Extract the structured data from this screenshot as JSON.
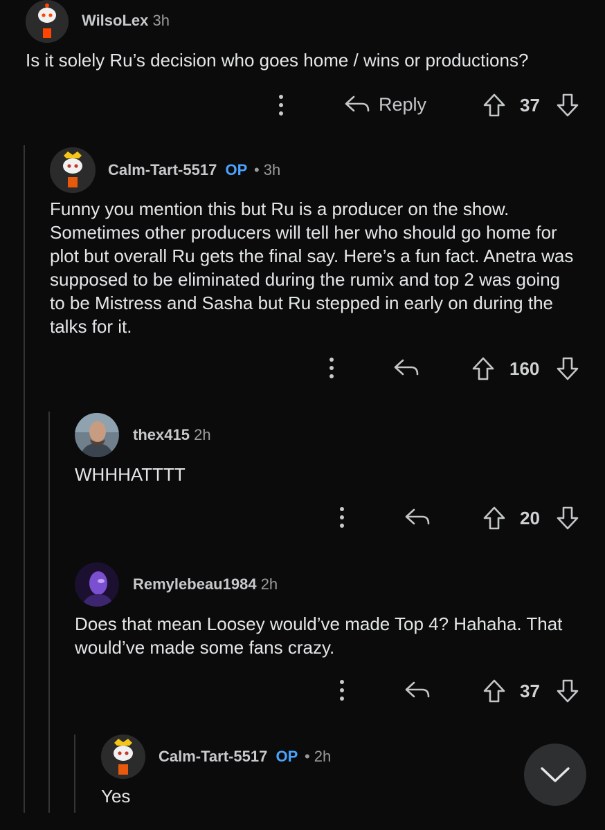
{
  "comments": [
    {
      "username": "WilsoLex",
      "time": "3h",
      "op_badge": "",
      "body": "Is it solely Ru’s decision who goes home / wins or productions?",
      "reply_label": "Reply",
      "votes": "37",
      "avatar_icon": "snoo-avatar-icon"
    },
    {
      "username": "Calm-Tart-5517",
      "time": "3h",
      "op_badge": "OP",
      "separator": "•",
      "body": "Funny you mention this but Ru is a producer on the show. Sometimes other producers will tell her who should go home for plot but overall Ru gets the final say. Here’s a fun fact. Anetra was supposed to be eliminated during the rumix and top 2 was going to be Mistress and Sasha but Ru stepped in early on during the talks for it.",
      "votes": "160",
      "avatar_icon": "snoo-avatar-icon"
    },
    {
      "username": "thex415",
      "time": "2h",
      "op_badge": "",
      "body": "WHHHATTTT",
      "votes": "20",
      "avatar_icon": "photo-avatar-icon"
    },
    {
      "username": "Remylebeau1984",
      "time": "2h",
      "op_badge": "",
      "body": "Does that mean Loosey would’ve made Top 4? Hahaha. That would’ve made some fans crazy.",
      "votes": "37",
      "avatar_icon": "photo-avatar-icon"
    },
    {
      "username": "Calm-Tart-5517",
      "time": "2h",
      "op_badge": "OP",
      "separator": "•",
      "body": "Yes",
      "avatar_icon": "snoo-avatar-icon"
    }
  ],
  "fab_icon": "chevron-down-icon",
  "colors": {
    "background": "#0b0b0b",
    "op": "#4aa3ff",
    "thread_line": "#343536"
  }
}
